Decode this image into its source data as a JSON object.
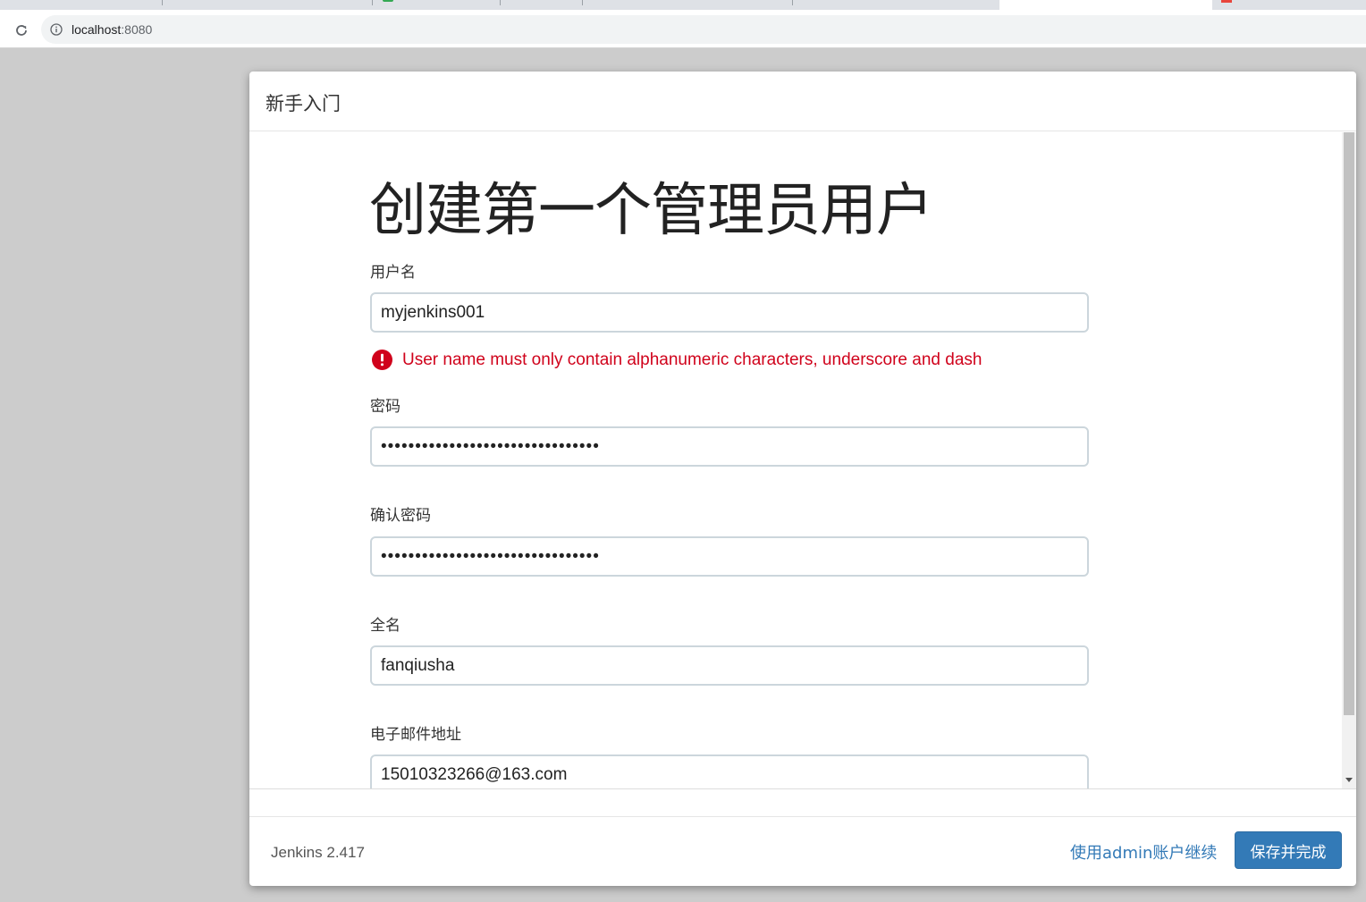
{
  "browser": {
    "url_host": "localhost",
    "url_port": ":8080"
  },
  "dialog": {
    "title": "新手入门",
    "heading": "创建第一个管理员用户",
    "username": {
      "label": "用户名",
      "value": "myjenkins001"
    },
    "username_error": "User name must only contain alphanumeric characters, underscore and dash",
    "password": {
      "label": "密码",
      "value": "••••••••••••••••••••••••••••••••"
    },
    "confirm_password": {
      "label": "确认密码",
      "value": "••••••••••••••••••••••••••••••••"
    },
    "fullname": {
      "label": "全名",
      "value": "fanqiusha"
    },
    "email": {
      "label": "电子邮件地址",
      "value": "15010323266@163.com"
    },
    "footer": {
      "version": "Jenkins 2.417",
      "skip_link": "使用admin账户继续",
      "save_button": "保存并完成"
    }
  },
  "colors": {
    "error": "#d0021b",
    "primary": "#337ab7",
    "page_background": "#cccccc"
  }
}
